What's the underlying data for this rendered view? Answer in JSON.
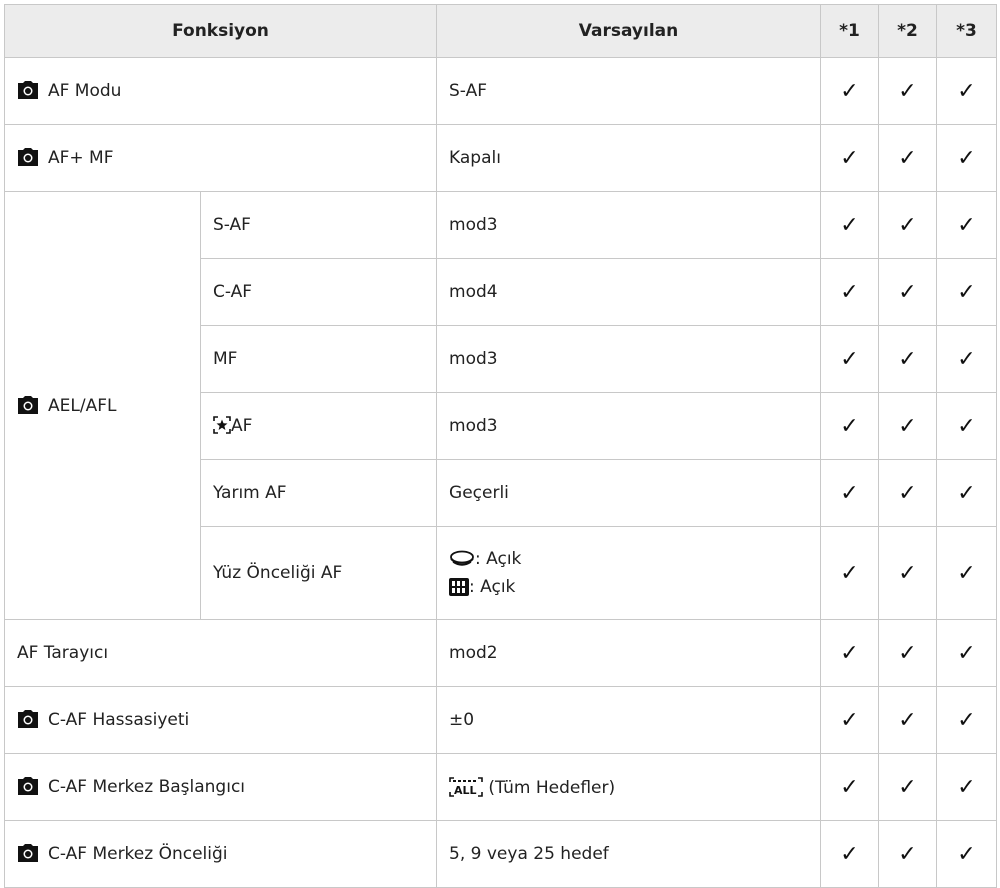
{
  "header": {
    "function": "Fonksiyon",
    "default": "Varsayılan",
    "col1": "*1",
    "col2": "*2",
    "col3": "*3"
  },
  "check_mark": "✓",
  "rows": {
    "af_mode": {
      "label": "AF Modu",
      "default": "S-AF"
    },
    "af_mf": {
      "label": "AF+ MF",
      "default": "Kapalı"
    },
    "ael": {
      "label": "AEL/AFL",
      "sub": [
        {
          "label": "S-AF",
          "default": "mod3"
        },
        {
          "label": "C-AF",
          "default": "mod4"
        },
        {
          "label": "MF",
          "default": "mod3"
        },
        {
          "label": "AF",
          "default": "mod3"
        },
        {
          "label": "Yarım AF",
          "default": "Geçerli"
        },
        {
          "label": "Yüz Önceliği AF",
          "default_line1": ": Açık",
          "default_line2": ": Açık"
        }
      ]
    },
    "af_scanner": {
      "label": "AF Tarayıcı",
      "default": "mod2"
    },
    "caf_sens": {
      "label": "C-AF Hassasiyeti",
      "default": "±0"
    },
    "caf_center_start": {
      "label": "C-AF Merkez Başlangıcı",
      "default": "(Tüm Hedefler)"
    },
    "caf_center_prio": {
      "label": "C-AF Merkez Önceliği",
      "default": "5, 9 veya 25 hedef"
    }
  },
  "icons": {
    "camera": "camera-icon",
    "star": "face-star-af-icon",
    "face": "face-detect-icon",
    "ael_afl": "ael-afl-icon",
    "all_targets": "all-targets-icon"
  }
}
